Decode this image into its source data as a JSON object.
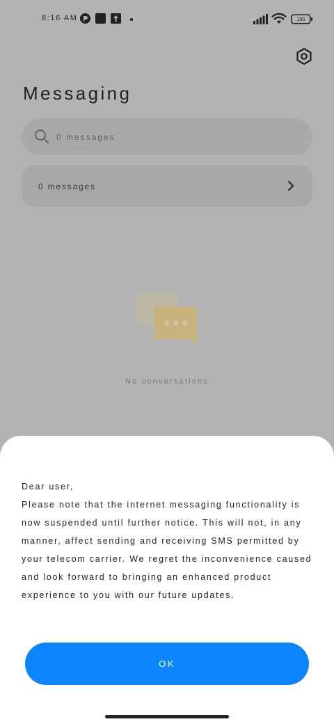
{
  "status_bar": {
    "time": "8:16 AM",
    "battery": "100",
    "icons": [
      "notification-app-icon",
      "square-app-icon",
      "upload-icon",
      "signal-icon",
      "wifi-icon",
      "battery-icon"
    ]
  },
  "header": {
    "title": "Messaging",
    "settings_icon": "gear-icon"
  },
  "search": {
    "placeholder": "0 messages",
    "icon": "search-icon"
  },
  "summary_row": {
    "label": "0 messages",
    "icon": "chevron-right-icon"
  },
  "empty_state": {
    "text": "No conversations",
    "illustration": "chat-bubbles-icon",
    "color": "#d4b15a"
  },
  "dialog": {
    "lines": [
      "Dear user,",
      "Please note that the internet messaging functionality is",
      "now suspended until further notice. This will not, in any",
      "manner, affect sending and receiving SMS permitted by",
      "your telecom carrier. We regret the inconvenience caused",
      "and look forward to bringing an enhanced product",
      "experience to you with our future updates."
    ],
    "ok_label": "OK"
  },
  "colors": {
    "overlay_background": "#b3b3b3",
    "accent": "#0b84fe"
  }
}
